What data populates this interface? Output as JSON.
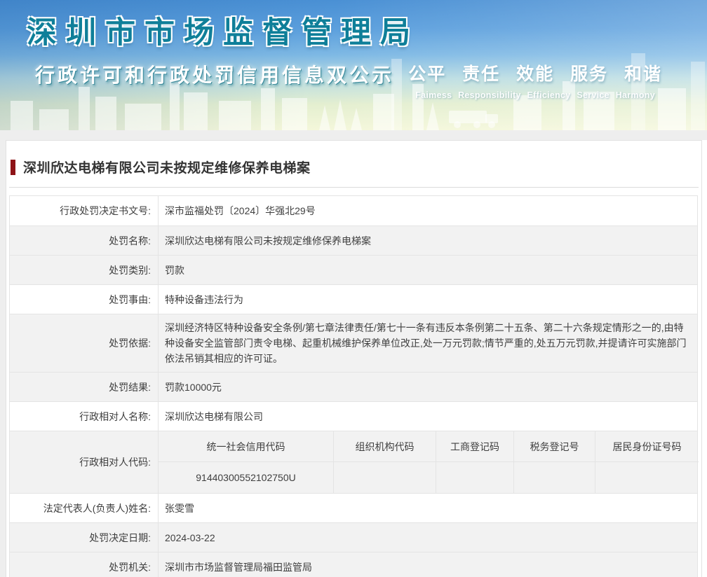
{
  "banner": {
    "title": "深圳市市场监督管理局",
    "subtitle": "行政许可和行政处罚信用信息双公示",
    "motto_cn": "公平 责任 效能 服务 和谐",
    "motto_en": "Faimess Responsibility Efficiency Service Harmony"
  },
  "page": {
    "title": "深圳欣达电梯有限公司未按规定维修保养电梯案"
  },
  "colors": {
    "banner_teal": "#0f7f99",
    "accent_maroon": "#8e1418",
    "strip_maroon": "#801114",
    "row_shade": "#f2f2f2",
    "table_border": "#e4e4e4"
  },
  "table": {
    "rows": [
      {
        "label": "行政处罚决定书文号:",
        "value": "深市监福处罚〔2024〕华强北29号",
        "shade": false
      },
      {
        "label": "处罚名称:",
        "value": "深圳欣达电梯有限公司未按规定维修保养电梯案",
        "shade": true
      },
      {
        "label": "处罚类别:",
        "value": "罚款",
        "shade": true
      },
      {
        "label": "处罚事由:",
        "value": "特种设备违法行为",
        "shade": false
      },
      {
        "label": "处罚依据:",
        "value": "深圳经济特区特种设备安全条例/第七章法律责任/第七十一条有违反本条例第二十五条、第二十六条规定情形之一的,由特种设备安全监管部门责令电梯、起重机械维护保养单位改正,处一万元罚款;情节严重的,处五万元罚款,并提请许可实施部门依法吊销其相应的许可证。",
        "shade": true,
        "multiline": true
      },
      {
        "label": "处罚结果:",
        "value": "罚款10000元",
        "shade": true
      },
      {
        "label": "行政相对人名称:",
        "value": "深圳欣达电梯有限公司",
        "shade": false
      },
      {
        "label": "行政相对人代码:",
        "type": "codes",
        "shade": true,
        "columns": [
          "统一社会信用代码",
          "组织机构代码",
          "工商登记码",
          "税务登记号",
          "居民身份证号码"
        ],
        "values": [
          "91440300552102750U",
          "",
          "",
          "",
          ""
        ]
      },
      {
        "label": "法定代表人(负责人)姓名:",
        "value": "张雯雪",
        "shade": false
      },
      {
        "label": "处罚决定日期:",
        "value": "2024-03-22",
        "shade": true
      },
      {
        "label": "处罚机关:",
        "value": "深圳市市场监督管理局福田监管局",
        "shade": true
      }
    ]
  }
}
